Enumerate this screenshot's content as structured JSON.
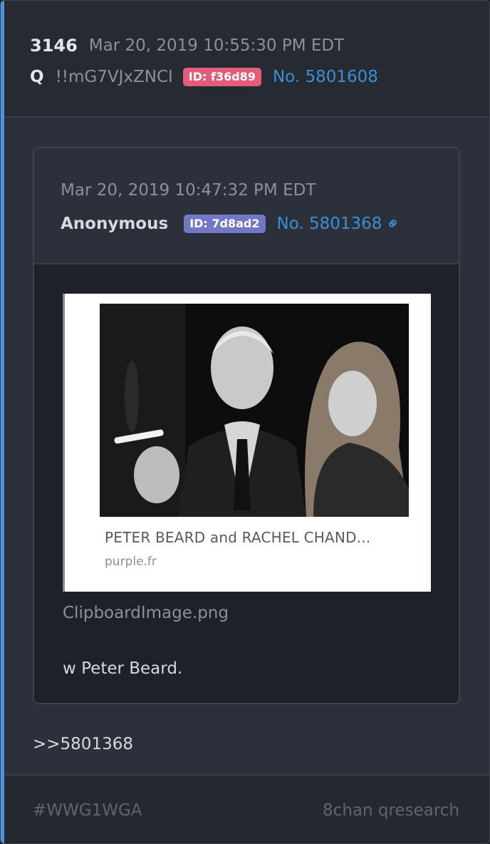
{
  "post": {
    "number": "3146",
    "date": "Mar 20, 2019 10:55:30 PM EDT",
    "author": "Q",
    "tripcode": "!!mG7VJxZNCI",
    "id_badge": "ID: f36d89",
    "id_color": "#e35c78",
    "post_link": "No. 5801608",
    "reply_reference": ">>5801368"
  },
  "quoted_post": {
    "date": "Mar 20, 2019 10:47:32 PM EDT",
    "author": "Anonymous",
    "id_badge": "ID: 7d8ad2",
    "id_color": "#7178c4",
    "post_link": "No. 5801368",
    "link_icon": "link-icon",
    "attachment": {
      "caption_title": "PETER BEARD and RACHEL CHAND...",
      "caption_domain": "purple.fr",
      "filename": "ClipboardImage.png"
    },
    "message": "w Peter Beard."
  },
  "footer": {
    "hashtag": "#WWG1WGA",
    "source": "8chan qresearch"
  },
  "accent_color": "#4b92e2"
}
